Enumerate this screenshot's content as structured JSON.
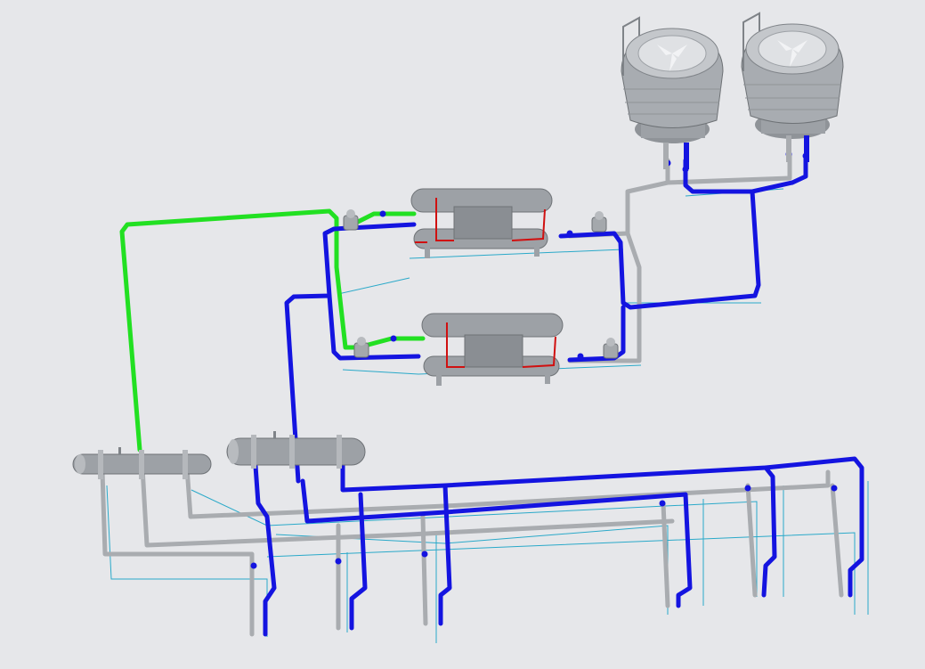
{
  "scene": {
    "description_visible_text": "",
    "colors": {
      "background": "#e6e7ea",
      "supply_pipe": "#1414e0",
      "gray_pipe": "#a9acb0",
      "green_pipe": "#22e022",
      "thin_line": "#2aa9c9",
      "equipment_body": "#9da1a6",
      "equipment_dark": "#7f8388",
      "accent_red": "#d01010"
    }
  },
  "components": {
    "cooling_towers": [
      "cooling-tower-1",
      "cooling-tower-2"
    ],
    "chillers": [
      "chiller-1",
      "chiller-2"
    ],
    "headers": [
      "distribution-header-1",
      "distribution-header-2"
    ]
  }
}
